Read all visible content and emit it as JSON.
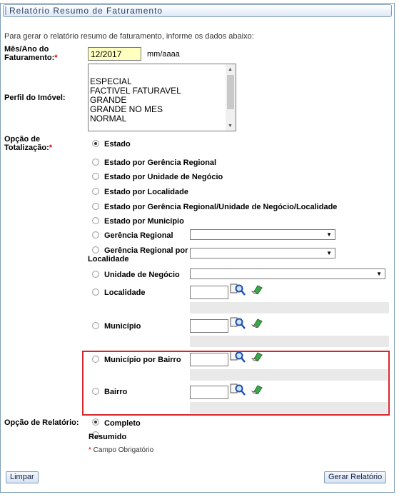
{
  "title": "Relatório Resumo de Faturamento",
  "instruction": "Para gerar o relatório resumo de faturamento, informe os dados abaixo:",
  "mes_ano": {
    "label_line1": "Mês/Ano do",
    "label_line2": "Faturamento:",
    "required_mark": "*",
    "value": "12/2017",
    "format_hint": "mm/aaaa"
  },
  "perfil": {
    "label": "Perfil do Imóvel:",
    "options": [
      "ESPECIAL",
      "FACTIVEL FATURAVEL",
      "GRANDE",
      "GRANDE NO MES",
      "NORMAL"
    ]
  },
  "totalizacao": {
    "label_line1": "Opção de",
    "label_line2": "Totalização:",
    "required_mark": "*",
    "options": [
      "Estado",
      "Estado por Gerência Regional",
      "Estado por Unidade de Negócio",
      "Estado por Localidade",
      "Estado por Gerência Regional/Unidade de Negócio/Localidade",
      "Estado por Município",
      "Gerência Regional",
      "Gerência Regional por",
      "Localidade",
      "Unidade de Negócio",
      "Localidade",
      "Município",
      "Município  por Bairro",
      "Bairro"
    ],
    "selected": "Estado"
  },
  "relatorio": {
    "label": "Opção de Relatório:",
    "options": [
      "Completo",
      "Resumido"
    ],
    "selected": "Completo"
  },
  "required_note": {
    "mark": "*",
    "text": " Campo Obrigatório"
  },
  "buttons": {
    "limpar": "Limpar",
    "gerar": "Gerar Relatório"
  },
  "icons": {
    "dropdown": "chevron-down-icon",
    "lookup": "magnifier-icon",
    "clear": "eraser-icon"
  },
  "colors": {
    "highlight_box": "#d9262c",
    "required": "#cc0000",
    "input_highlight": "#ffffc0"
  }
}
